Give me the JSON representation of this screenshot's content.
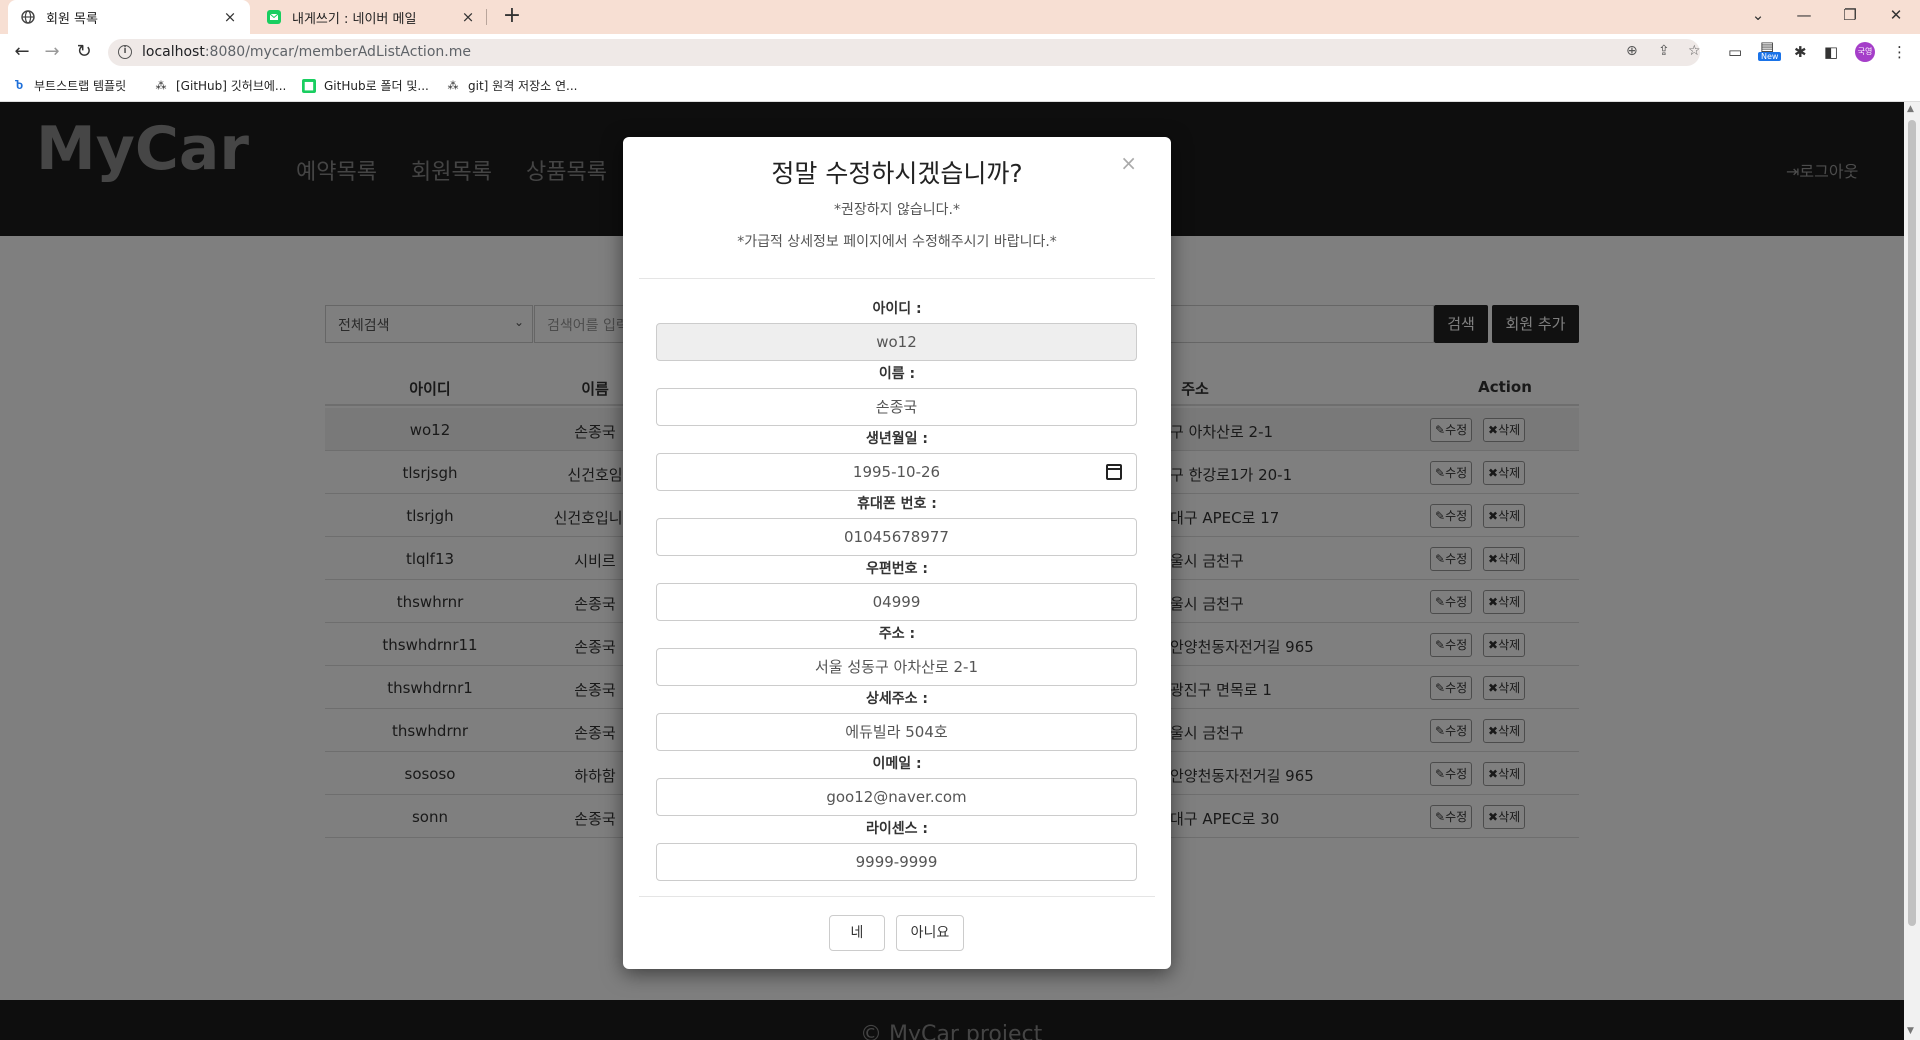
{
  "browser": {
    "tabs": [
      {
        "title": "회원 목록",
        "close": "×"
      },
      {
        "title": "내게쓰기 : 네이버 메일",
        "close": "×"
      }
    ],
    "new_tab": "+",
    "url_host": "localhost",
    "url_rest": ":8080/mycar/memberAdListAction.me",
    "new_badge": "New",
    "profile": "국영",
    "bookmarks": [
      "부트스트랩 템플릿",
      "[GitHub] 깃허브에...",
      "GitHub로 폴더 및...",
      "git] 원격 저장소 연..."
    ]
  },
  "site": {
    "logo": "MyCar",
    "nav": [
      "예약목록",
      "회원목록",
      "상품목록"
    ],
    "logout": "로그아웃",
    "footer": "© MyCar project"
  },
  "search": {
    "select_value": "전체검색",
    "placeholder": "검색어를 입력",
    "search_button": "검색",
    "add_button": "회원 추가"
  },
  "table": {
    "headers": {
      "id": "아이디",
      "name": "이름",
      "address": "주소",
      "action": "Action"
    },
    "edit_label": "수정",
    "delete_label": "삭제",
    "rows": [
      {
        "id": "wo12",
        "name": "손종국",
        "address": "구 아차산로 2-1"
      },
      {
        "id": "tlsrjsgh",
        "name": "신건호임",
        "address": "구 한강로1가 20-1"
      },
      {
        "id": "tlsrjgh",
        "name": "신건호입니다",
        "address": "대구 APEC로 17"
      },
      {
        "id": "tlqlf13",
        "name": "시비르",
        "address": "울시 금천구"
      },
      {
        "id": "thswhrnr",
        "name": "손종국",
        "address": "울시 금천구"
      },
      {
        "id": "thswhdrnr11",
        "name": "손종국",
        "address": "안양천동자전거길 965"
      },
      {
        "id": "thswhdrnr1",
        "name": "손종국",
        "address": "광진구 면목로 1"
      },
      {
        "id": "thswhdrnr",
        "name": "손종국",
        "address": "울시 금천구"
      },
      {
        "id": "sososo",
        "name": "하하함",
        "address": "안양천동자전거길 965"
      },
      {
        "id": "sonn",
        "name": "손종국",
        "address": "대구 APEC로 30"
      }
    ]
  },
  "modal": {
    "close": "×",
    "title": "정말 수정하시겠습니까?",
    "subtitle1": "*권장하지 않습니다.*",
    "subtitle2": "*가급적 상세정보 페이지에서 수정해주시기 바랍니다.*",
    "fields": [
      {
        "label": "아이디 :",
        "value": "wo12"
      },
      {
        "label": "이름 :",
        "value": "손종국"
      },
      {
        "label": "생년월일 :",
        "value": "1995-10-26"
      },
      {
        "label": "휴대폰 번호 :",
        "value": "01045678977"
      },
      {
        "label": "우편번호 :",
        "value": "04999"
      },
      {
        "label": "주소 :",
        "value": "서울 성동구 아차산로 2-1"
      },
      {
        "label": "상세주소 :",
        "value": "에듀빌라 504호"
      },
      {
        "label": "이메일 :",
        "value": "goo12@naver.com"
      },
      {
        "label": "라이센스 :",
        "value": "9999-9999"
      }
    ],
    "yes": "네",
    "no": "아니요"
  }
}
